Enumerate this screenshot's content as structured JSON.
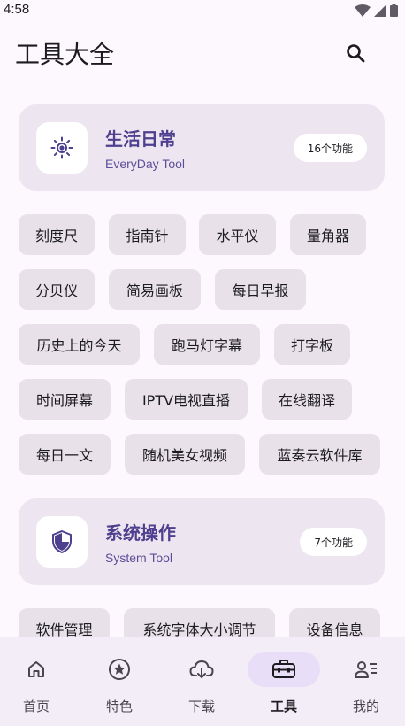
{
  "status_bar": {
    "time": "4:58"
  },
  "header": {
    "title": "工具大全"
  },
  "sections": [
    {
      "title": "生活日常",
      "subtitle": "EveryDay Tool",
      "badge": "16个功能",
      "icon": "sun-icon",
      "tools": [
        "刻度尺",
        "指南针",
        "水平仪",
        "量角器",
        "分贝仪",
        "简易画板",
        "每日早报",
        "历史上的今天",
        "跑马灯字幕",
        "打字板",
        "时间屏幕",
        "IPTV电视直播",
        "在线翻译",
        "每日一文",
        "随机美女视频",
        "蓝奏云软件库"
      ]
    },
    {
      "title": "系统操作",
      "subtitle": "System Tool",
      "badge": "7个功能",
      "icon": "shield-icon",
      "tools": [
        "软件管理",
        "系统字体大小调节",
        "设备信息"
      ]
    }
  ],
  "bottom_nav": [
    {
      "label": "首页",
      "icon": "home-icon"
    },
    {
      "label": "特色",
      "icon": "star-circle-icon"
    },
    {
      "label": "下载",
      "icon": "cloud-download-icon"
    },
    {
      "label": "工具",
      "icon": "toolbox-icon",
      "active": true
    },
    {
      "label": "我的",
      "icon": "profile-icon"
    }
  ],
  "colors": {
    "accent": "#4e3f8f",
    "background": "#fdf7fe",
    "card": "#ede6f0",
    "chip": "#e8e1ea",
    "nav_active": "#e8def8"
  }
}
